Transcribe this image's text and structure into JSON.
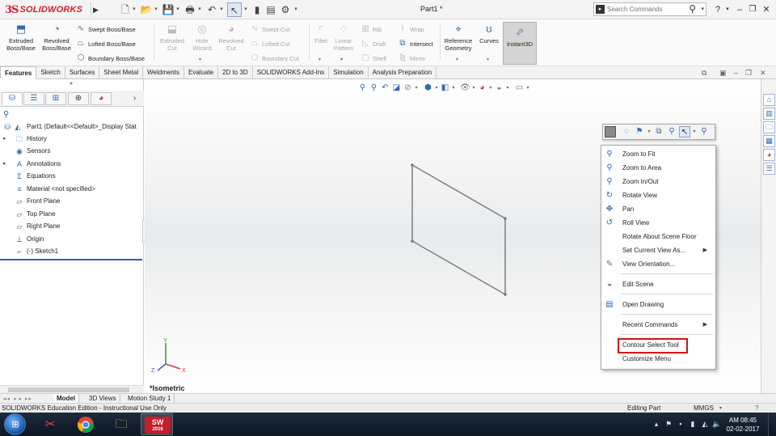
{
  "app": {
    "brand_ds": "3S",
    "brand_name": "SOLIDWORKS",
    "document_title": "Part1 *"
  },
  "search": {
    "placeholder": "Search Commands"
  },
  "commands": {
    "extruded_boss": "Extruded Boss/Base",
    "revolved_boss": "Revolved Boss/Base",
    "swept_boss": "Swept Boss/Base",
    "lofted_boss": "Lofted Boss/Base",
    "boundary_boss": "Boundary Boss/Base",
    "extruded_cut": "Extruded Cut",
    "hole_wizard": "Hole Wizard",
    "revolved_cut": "Revolved Cut",
    "swept_cut": "Swept Cut",
    "lofted_cut": "Lofted Cut",
    "boundary_cut": "Boundary Cut",
    "fillet": "Fillet",
    "linear_pattern": "Linear Pattern",
    "rib": "Rib",
    "draft": "Draft",
    "shell": "Shell",
    "wrap": "Wrap",
    "intersect": "Intersect",
    "mirror": "Mirror",
    "reference_geometry": "Reference Geometry",
    "curves": "Curves",
    "instant3d": "Instant3D"
  },
  "tabs": [
    "Features",
    "Sketch",
    "Surfaces",
    "Sheet Metal",
    "Weldments",
    "Evaluate",
    "2D to 3D",
    "SOLIDWORKS Add-Ins",
    "Simulation",
    "Analysis Preparation"
  ],
  "tree": {
    "root": "Part1  (Default<<Default>_Display Stat",
    "items": [
      "History",
      "Sensors",
      "Annotations",
      "Equations",
      "Material <not specified>",
      "Front Plane",
      "Top Plane",
      "Right Plane",
      "Origin",
      "(-) Sketch1"
    ]
  },
  "graphics": {
    "view_label": "*Isometric"
  },
  "context_menu": {
    "items": [
      "Zoom to Fit",
      "Zoom to Area",
      "Zoom In/Out",
      "Rotate View",
      "Pan",
      "Roll View",
      "Rotate About Scene Floor",
      "Set Current View As...",
      "View Orientation...",
      "Edit Scene",
      "Open Drawing",
      "Recent Commands",
      "Contour Select Tool",
      "Customize Menu"
    ]
  },
  "bottom_tabs": [
    "Model",
    "3D Views",
    "Motion Study 1"
  ],
  "status": {
    "left": "SOLIDWORKS Education Edition - Instructional Use Only",
    "mode": "Editing Part",
    "units": "MMGS"
  },
  "taskbar": {
    "sw_label": "SW",
    "sw_year": "2016",
    "time": "AM 08:45",
    "date": "02-02-2017"
  },
  "colors": {
    "brand_red": "#d0202e",
    "accent_blue": "#2f6ab0",
    "highlight_red": "#d0121b"
  }
}
